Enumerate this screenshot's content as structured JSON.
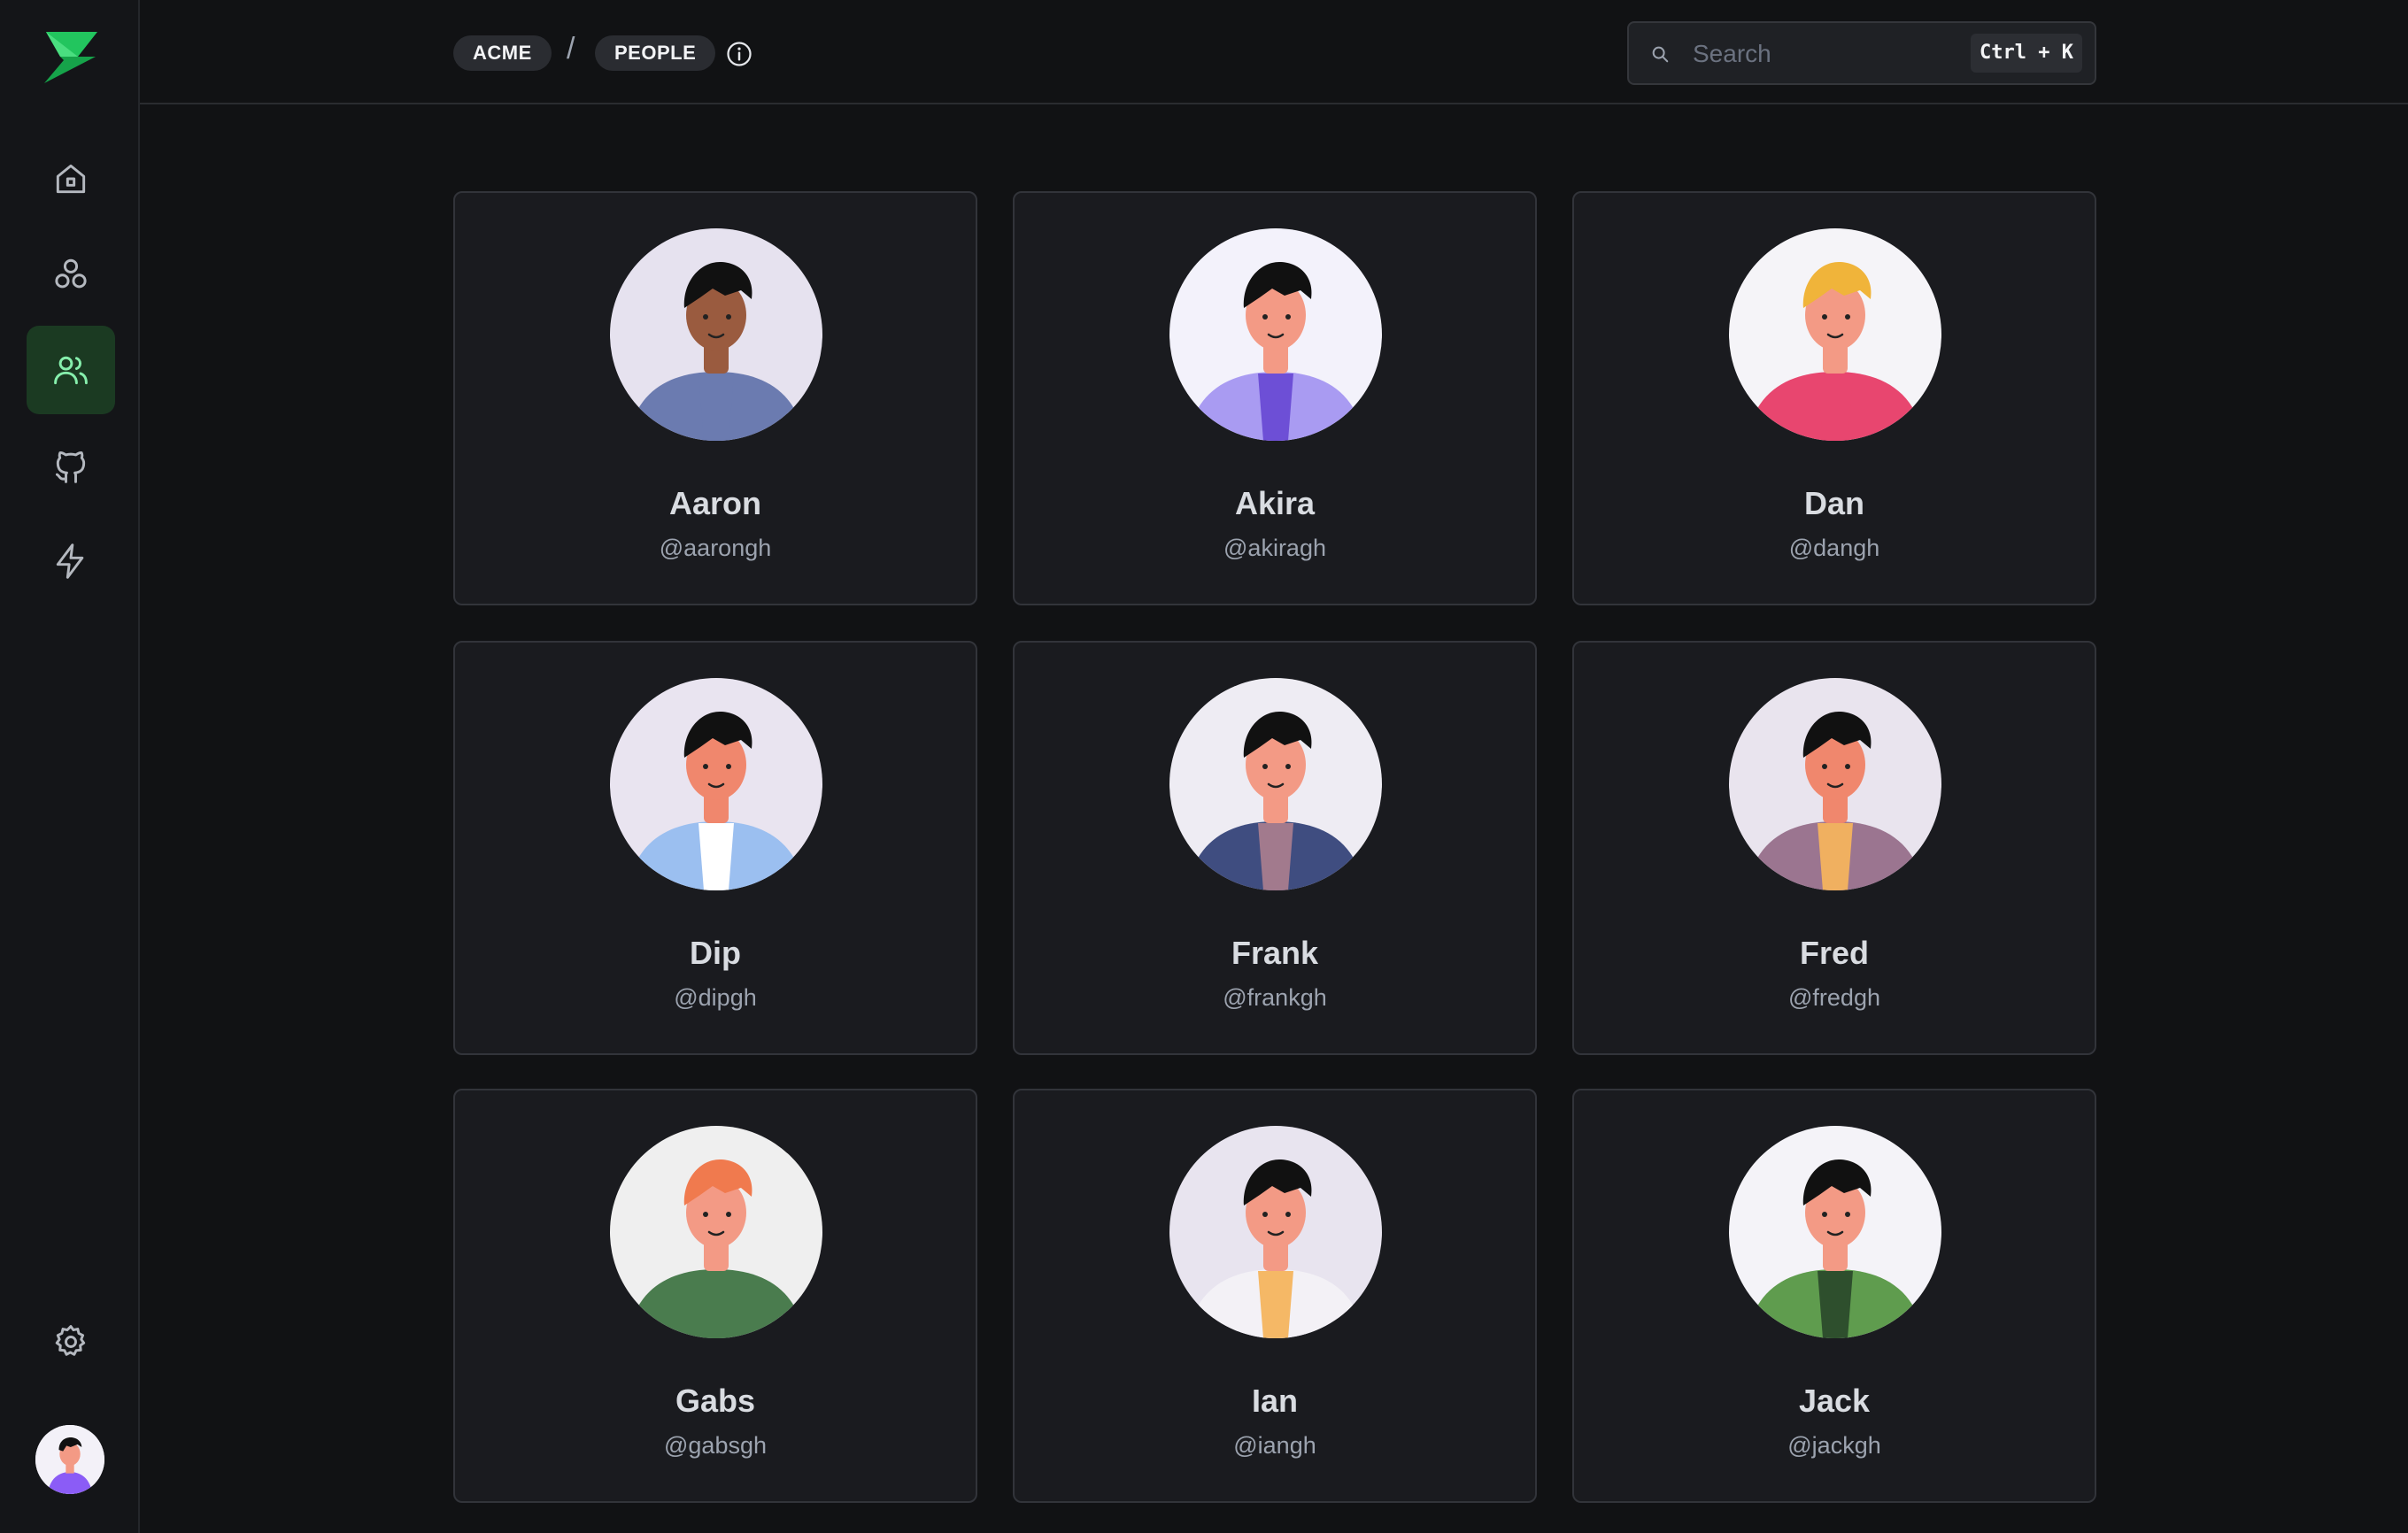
{
  "breadcrumb": {
    "org": "ACME",
    "separator": "/",
    "page": "PEOPLE"
  },
  "search": {
    "placeholder": "Search",
    "shortcut": "Ctrl + K"
  },
  "sidebar": {
    "items": [
      {
        "name": "home-icon",
        "active": false
      },
      {
        "name": "circles-icon",
        "active": false
      },
      {
        "name": "users-icon",
        "active": true
      },
      {
        "name": "github-icon",
        "active": false
      },
      {
        "name": "lightning-icon",
        "active": false
      }
    ],
    "bottom": [
      "gear-icon",
      "user-avatar"
    ]
  },
  "people": [
    {
      "name": "Aaron",
      "handle": "@aarongh",
      "bg": "#e6e2ef",
      "skin": "#9a5b3f",
      "hair": "#111111",
      "shirt": "#6b7bb0",
      "inner": "#6b7bb0"
    },
    {
      "name": "Akira",
      "handle": "@akiragh",
      "bg": "#f3f2fb",
      "skin": "#f39a85",
      "hair": "#111111",
      "shirt": "#a99bf2",
      "inner": "#6d4fd6"
    },
    {
      "name": "Dan",
      "handle": "@dangh",
      "bg": "#f5f4f8",
      "skin": "#f39a85",
      "hair": "#f0b43a",
      "shirt": "#e8466f",
      "inner": "#e8466f"
    },
    {
      "name": "Dip",
      "handle": "@dipgh",
      "bg": "#e9e4f0",
      "skin": "#f0876d",
      "hair": "#111111",
      "shirt": "#9bbff0",
      "inner": "#ffffff"
    },
    {
      "name": "Frank",
      "handle": "@frankgh",
      "bg": "#eeecf3",
      "skin": "#f39a85",
      "hair": "#111111",
      "shirt": "#3f4d80",
      "inner": "#a27a8d"
    },
    {
      "name": "Fred",
      "handle": "@fredgh",
      "bg": "#e9e4ee",
      "skin": "#f0876d",
      "hair": "#111111",
      "shirt": "#9b7590",
      "inner": "#f0b060"
    },
    {
      "name": "Gabs",
      "handle": "@gabsgh",
      "bg": "#efefef",
      "skin": "#f39a85",
      "hair": "#f07a4e",
      "shirt": "#4a7c4e",
      "inner": "#4a7c4e"
    },
    {
      "name": "Ian",
      "handle": "@iangh",
      "bg": "#e8e4ef",
      "skin": "#f39a85",
      "hair": "#111111",
      "shirt": "#f3f1f6",
      "inner": "#f5b866"
    },
    {
      "name": "Jack",
      "handle": "@jackgh",
      "bg": "#f4f3f8",
      "skin": "#f39a85",
      "hair": "#111111",
      "shirt": "#5f9c4e",
      "inner": "#2e4f2d"
    }
  ],
  "colors": {
    "accent": "#22c55e",
    "active_nav_bg": "#1b3a22"
  }
}
